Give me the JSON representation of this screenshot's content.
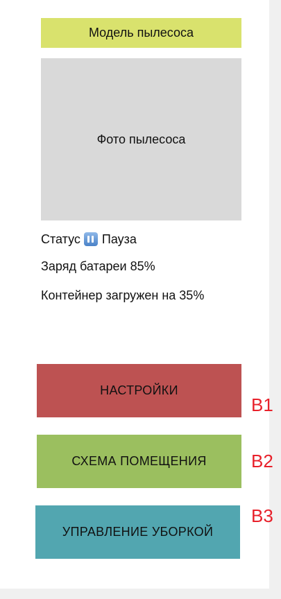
{
  "header": {
    "model_label": "Модель пылесоса"
  },
  "photo": {
    "placeholder_label": "Фото пылесоса"
  },
  "status": {
    "label": "Статус",
    "icon": "pause-icon",
    "value": "Пауза"
  },
  "battery": {
    "text": "Заряд батареи 85%",
    "level_percent": 85
  },
  "container": {
    "text": "Контейнер загружен на 35%",
    "fill_percent": 35
  },
  "buttons": [
    {
      "label": "НАСТРОЙКИ",
      "tag": "B1",
      "color": "#bd5252"
    },
    {
      "label": "СХЕМА ПОМЕЩЕНИЯ",
      "tag": "B2",
      "color": "#9bbf5f"
    },
    {
      "label": "УПРАВЛЕНИЕ УБОРКОЙ",
      "tag": "B3",
      "color": "#52a6b0"
    }
  ],
  "colors": {
    "model_bar": "#d9e26d",
    "photo_placeholder": "#d9d9d9",
    "tag_text": "#e8202a"
  }
}
